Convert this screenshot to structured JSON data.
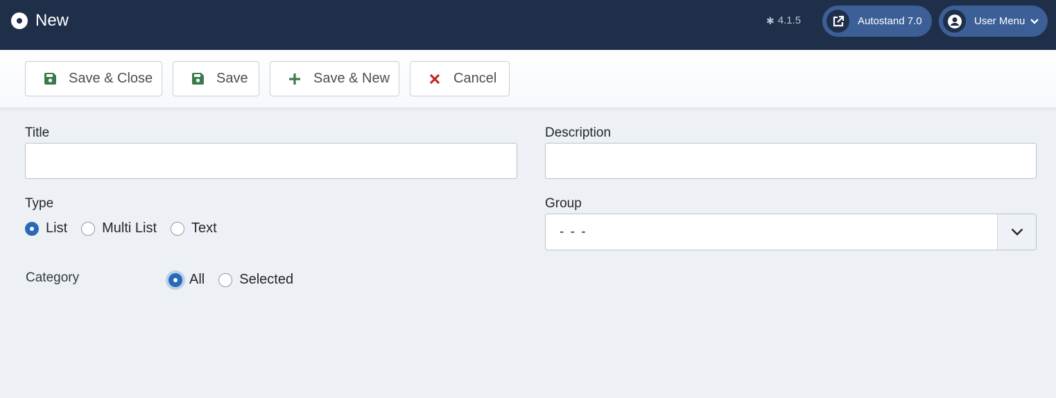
{
  "header": {
    "title": "New",
    "version": "4.1.5",
    "site_label": "Autostand 7.0",
    "user_label": "User Menu"
  },
  "toolbar": {
    "save_close": "Save & Close",
    "save": "Save",
    "save_new": "Save & New",
    "cancel": "Cancel"
  },
  "form": {
    "title_label": "Title",
    "title_value": "",
    "description_label": "Description",
    "description_value": "",
    "type_label": "Type",
    "type_options": [
      "List",
      "Multi List",
      "Text"
    ],
    "type_selected": "List",
    "group_label": "Group",
    "group_value": "- - -",
    "category_label": "Category",
    "category_options": [
      "All",
      "Selected"
    ],
    "category_selected": "All"
  },
  "colors": {
    "header_bg": "#1f2f4a",
    "pill_bg": "#3b5f96",
    "accent": "#2a69b8",
    "save_icon": "#3d7a4a",
    "cancel_icon": "#c52827"
  }
}
